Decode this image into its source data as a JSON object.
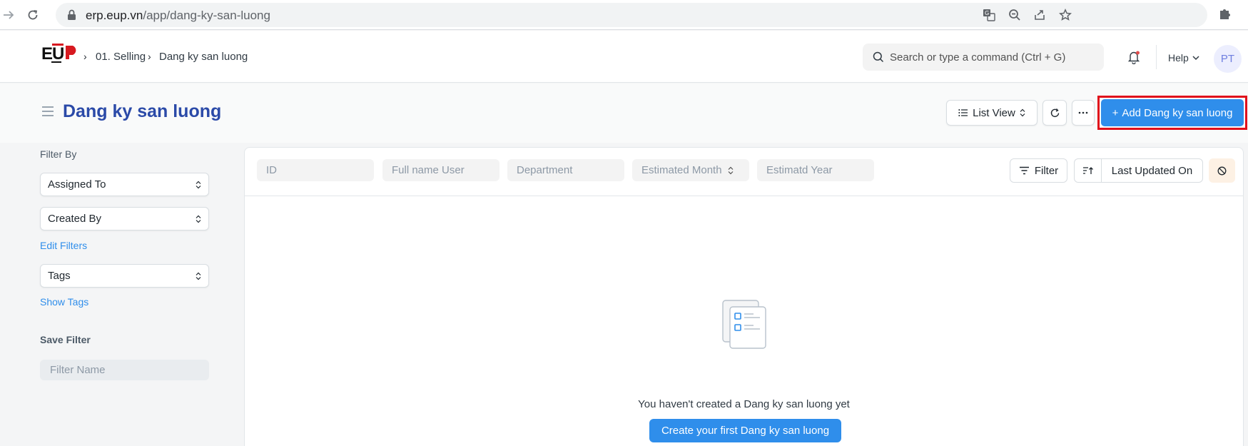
{
  "browser": {
    "url_host": "erp.eup.vn",
    "url_path": "/app/dang-ky-san-luong",
    "icons": [
      "back-arrow-icon",
      "reload-icon",
      "lock-icon",
      "translate-icon",
      "zoom-icon",
      "share-icon",
      "star-icon",
      "extensions-icon"
    ]
  },
  "navbar": {
    "breadcrumbs": [
      "01. Selling",
      "Dang ky san luong"
    ],
    "search_placeholder": "Search or type a command (Ctrl + G)",
    "help_label": "Help",
    "avatar_initials": "PT"
  },
  "header": {
    "title": "Dang ky san luong",
    "list_view_label": "List View",
    "add_button_label": "Add Dang ky san luong",
    "add_button_prefix": "+"
  },
  "sidebar": {
    "filter_by_label": "Filter By",
    "assigned_to_label": "Assigned To",
    "created_by_label": "Created By",
    "edit_filters_label": "Edit Filters",
    "tags_label": "Tags",
    "show_tags_label": "Show Tags",
    "save_filter_label": "Save Filter",
    "filter_name_placeholder": "Filter Name"
  },
  "filters": {
    "id_placeholder": "ID",
    "full_name_placeholder": "Full name User",
    "department_placeholder": "Department",
    "estimated_month_label": "Estimated Month",
    "estimated_year_placeholder": "Estimatd Year",
    "filter_button_label": "Filter",
    "sort_field_label": "Last Updated On"
  },
  "empty_state": {
    "message": "You haven't created a Dang ky san luong yet",
    "create_button_label": "Create your first Dang ky san luong"
  },
  "colors": {
    "primary": "#2f8eeb",
    "title_blue": "#2b4aa8",
    "highlight_red": "#e0101b"
  }
}
